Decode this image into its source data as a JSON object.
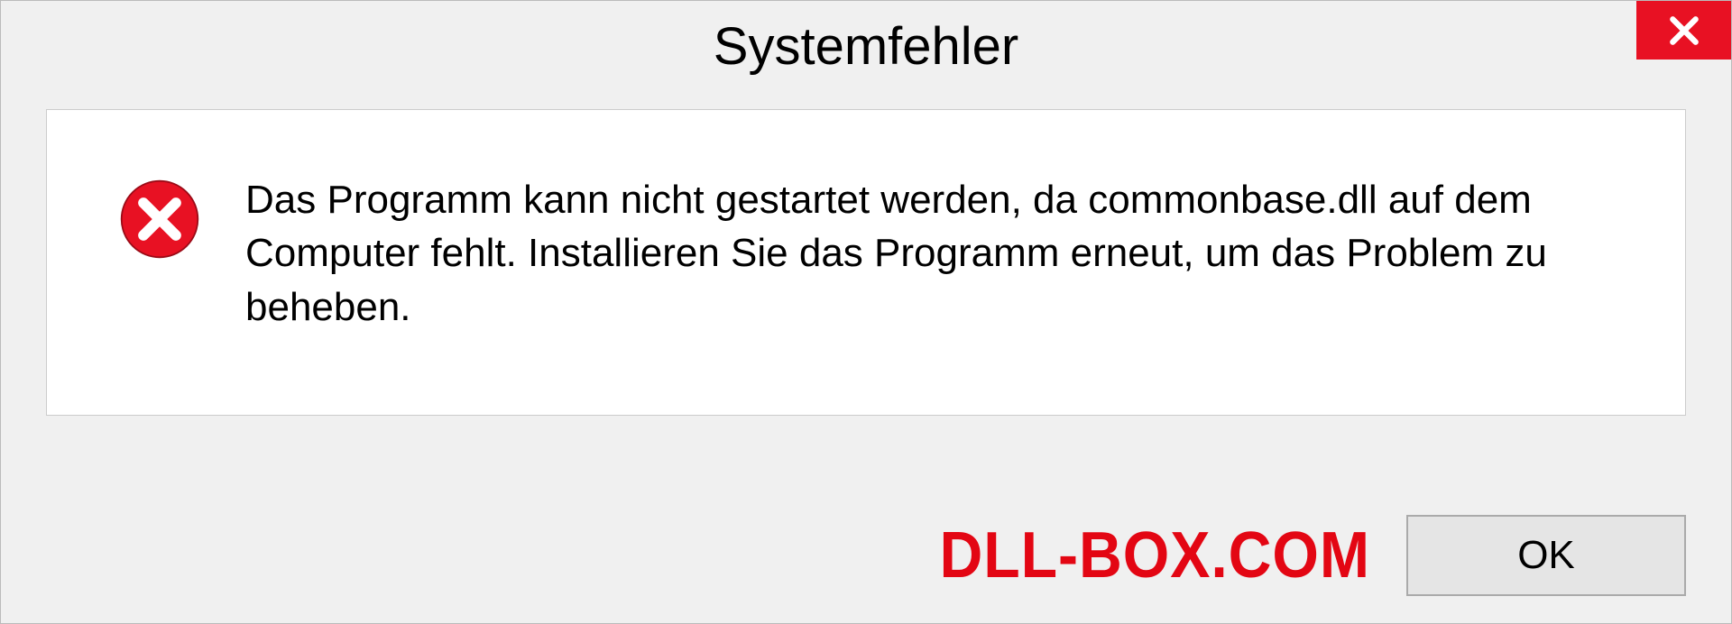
{
  "dialog": {
    "title": "Systemfehler",
    "message": "Das Programm kann nicht gestartet werden, da commonbase.dll auf dem Computer fehlt. Installieren Sie das Programm erneut, um das Problem zu beheben.",
    "ok_label": "OK"
  },
  "watermark": "DLL-BOX.COM",
  "colors": {
    "close_bg": "#e81123",
    "error_icon": "#e81123",
    "watermark": "#e30613"
  }
}
